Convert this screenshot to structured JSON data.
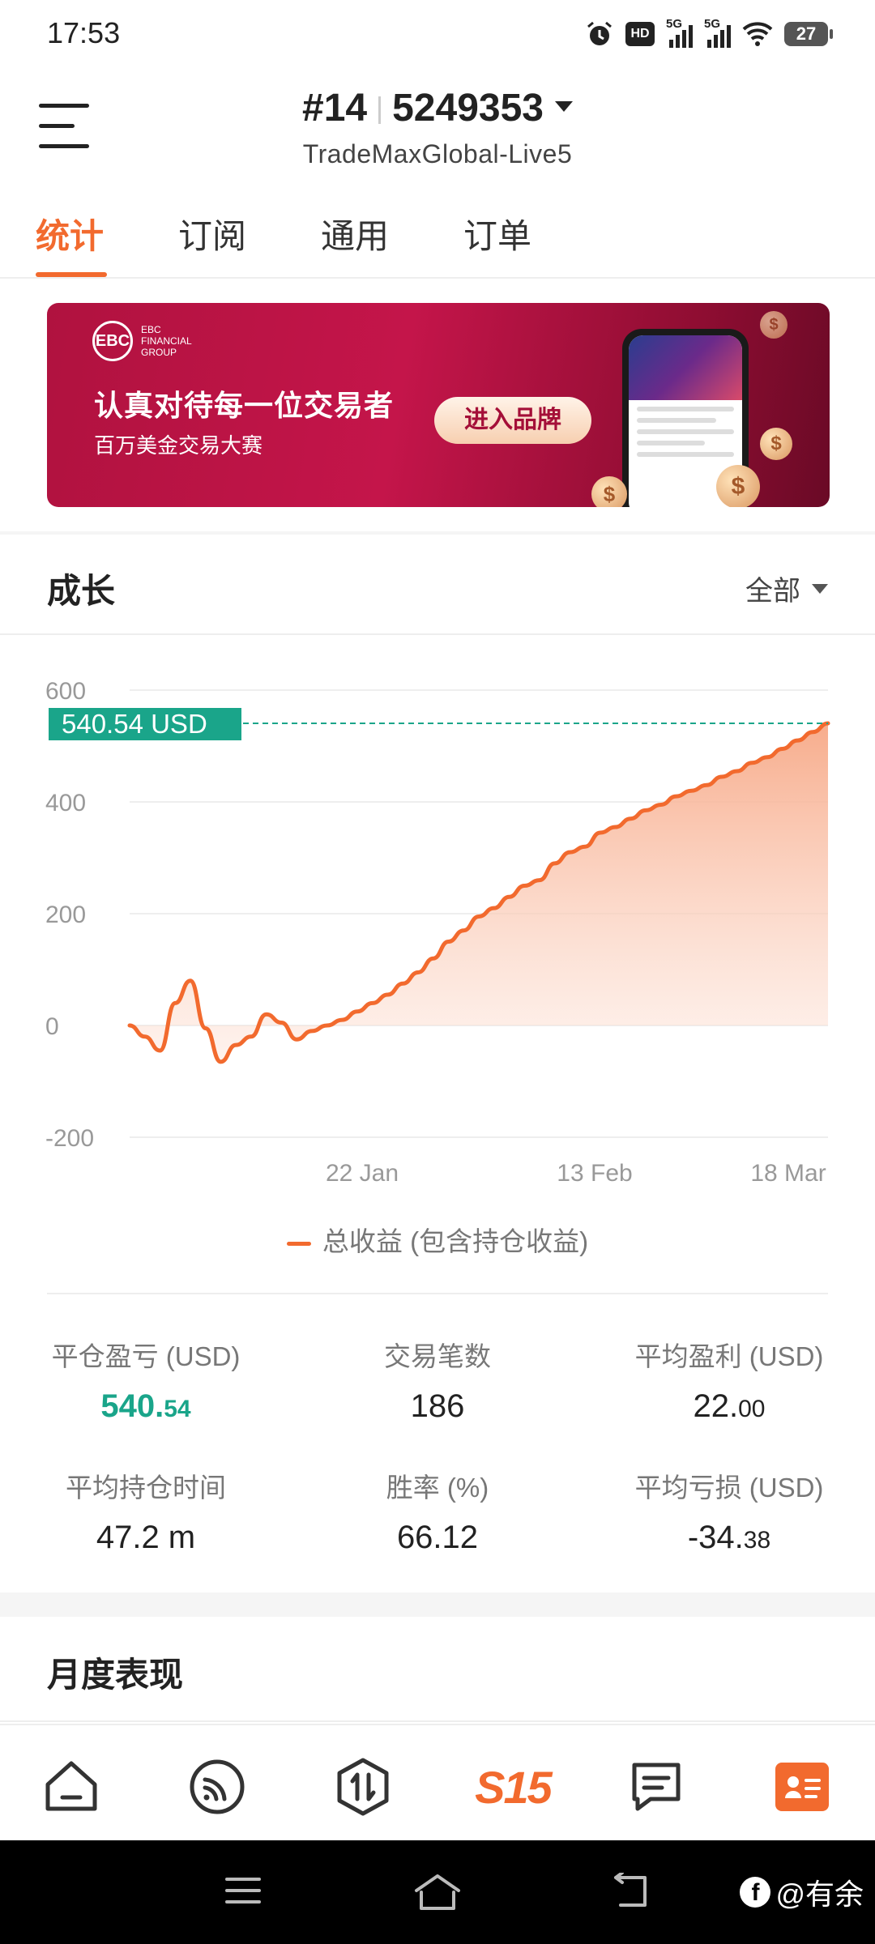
{
  "status_bar": {
    "time": "17:53",
    "network_label_1": "5G",
    "network_label_2": "5G",
    "hd_label": "HD",
    "battery_level": "27"
  },
  "header": {
    "account_prefix": "#14",
    "account_number": "5249353",
    "server": "TradeMaxGlobal-Live5"
  },
  "tabs": [
    {
      "label": "统计",
      "active": true
    },
    {
      "label": "订阅",
      "active": false
    },
    {
      "label": "通用",
      "active": false
    },
    {
      "label": "订单",
      "active": false
    }
  ],
  "banner": {
    "logo_mark": "EBC",
    "logo_text_1": "EBC",
    "logo_text_2": "FINANCIAL",
    "logo_text_3": "GROUP",
    "title": "认真对待每一位交易者",
    "subtitle": "百万美金交易大赛",
    "button_label": "进入品牌"
  },
  "growth": {
    "title": "成长",
    "range_label": "全部",
    "current_value_tag": "540.54 USD",
    "legend_label": "总收益 (包含持仓收益)"
  },
  "chart_data": {
    "type": "area",
    "x_ticks": [
      "22 Jan",
      "13 Feb",
      "18 Mar"
    ],
    "y_ticks": [
      600,
      400,
      200,
      0,
      -200
    ],
    "ylim": [
      -200,
      600
    ],
    "series": [
      {
        "name": "总收益 (包含持仓收益)",
        "color": "#f26a2e",
        "values": [
          0,
          -20,
          -45,
          40,
          80,
          -5,
          -65,
          -35,
          -20,
          20,
          5,
          -25,
          -10,
          0,
          10,
          25,
          40,
          55,
          75,
          95,
          120,
          150,
          170,
          195,
          210,
          230,
          250,
          260,
          290,
          310,
          320,
          345,
          355,
          370,
          385,
          395,
          410,
          420,
          430,
          445,
          455,
          470,
          480,
          495,
          510,
          525,
          540.54
        ]
      }
    ],
    "current_value": 540.54,
    "current_value_color": "#1aa58a"
  },
  "stats": [
    {
      "label": "平仓盈亏 (USD)",
      "value_main": "540.",
      "value_small": "54",
      "green": true
    },
    {
      "label": "交易笔数",
      "value_main": "186",
      "value_small": "",
      "green": false
    },
    {
      "label": "平均盈利 (USD)",
      "value_main": "22.",
      "value_small": "00",
      "green": false
    },
    {
      "label": "平均持仓时间",
      "value_main": "47.2 m",
      "value_small": "",
      "green": false
    },
    {
      "label": "胜率 (%)",
      "value_main": "66.12",
      "value_small": "",
      "green": false
    },
    {
      "label": "平均亏损 (USD)",
      "value_main": "-34.",
      "value_small": "38",
      "green": false
    }
  ],
  "monthly": {
    "title": "月度表现"
  },
  "bottom_nav": {
    "s15_label": "S15"
  },
  "watermark": {
    "text": "@有余",
    "logo_mark": "f"
  },
  "colors": {
    "accent": "#f26a2e",
    "positive": "#1aa58a",
    "banner": "#c4154a"
  }
}
